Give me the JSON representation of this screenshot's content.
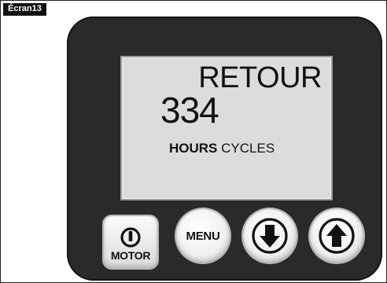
{
  "screen_tag": "Écran13",
  "lcd": {
    "title": "RETOUR",
    "value": "334",
    "units_bold": "HOURS",
    "units_regular": "CYCLES"
  },
  "buttons": {
    "motor_label": "MOTOR",
    "menu_label": "MENU",
    "down_icon": "arrow-down-icon",
    "up_icon": "arrow-up-icon",
    "power_icon": "power-icon"
  },
  "colors": {
    "device_body": "#2a2a2a",
    "lcd_background": "#dcdcdc",
    "tag_background": "#111111"
  }
}
